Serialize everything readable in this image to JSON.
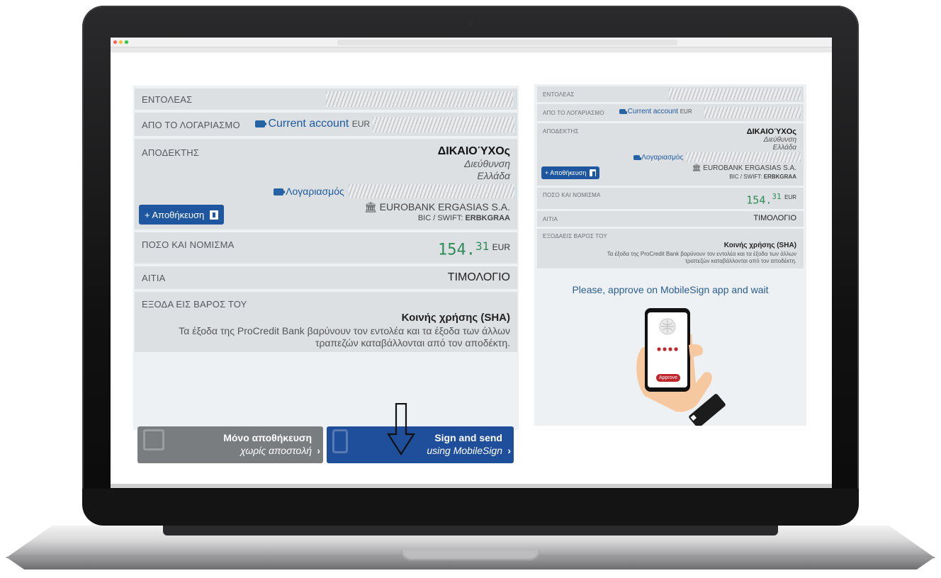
{
  "left": {
    "principal_label": "ΕΝΤΟΛΕΑΣ",
    "from_account_label": "ΑΠΟ ΤΟ ΛΟΓΑΡΙΑΣΜΟ",
    "from_account_name": "Current account",
    "from_account_currency": "EUR",
    "beneficiary_label": "ΑΠΟΔΕΚΤΗΣ",
    "beneficiary_name": "ΔΙΚΑΙΟΎΧΟς",
    "beneficiary_address": "Διεύθυνση",
    "beneficiary_country": "Ελλάδα",
    "account_link": "Λογαριασμός",
    "bank_name": "EUROBANK ERGASIAS S.A.",
    "bic_label": "BIC / SWIFT:",
    "bic_value": "ERBKGRAA",
    "save_button": "+ Αποθήκευση",
    "amount_label": "ΠΟΣΟ ΚΑΙ ΝΟΜΙΣΜΑ",
    "amount_int": "154.",
    "amount_dec": "31",
    "amount_currency": "EUR",
    "reason_label": "ΑΙΤΙΑ",
    "reason_value": "ΤΙΜΟΛΟΓΙΟ",
    "charges_label": "ΕΞΟΔΑ ΕΙΣ ΒΑΡΟΣ ΤΟΥ",
    "charges_value": "Κοινής χρήσης (SHA)",
    "charges_desc_1": "Τα έξοδα της ProCredit Bank βαρύνουν τον εντολέα και τα έξοδα των άλλων",
    "charges_desc_2": "τραπεζών καταβάλλονται από τον αποδέκτη.",
    "save_only_main": "Μόνο αποθήκευση",
    "save_only_sub": "χωρίς αποστολή",
    "sign_send_main": "Sign and send",
    "sign_send_sub": "using MobileSign",
    "chevron": "›"
  },
  "right": {
    "principal_label": "ΕΝΤΟΛΕΑΣ",
    "from_account_label": "ΑΠΟ ΤΟ ΛΟΓΑΡΙΑΣΜΟ",
    "from_account_name": "Current account",
    "from_account_currency": "EUR",
    "beneficiary_label": "ΑΠΟΔΕΚΤΗΣ",
    "beneficiary_name": "ΔΙΚΑΙΟΎΧΟς",
    "beneficiary_address": "Διεύθυνση",
    "beneficiary_country": "Ελλάδα",
    "account_link": "Λογαριασμός",
    "bank_name": "EUROBANK ERGASIAS S.A.",
    "bic_label": "BIC / SWIFT:",
    "bic_value": "ERBKGRAA",
    "save_button": "+ Αποθήκευση",
    "amount_label": "ΠΟΣΟ ΚΑΙ ΝΟΜΙΣΜΑ",
    "amount_int": "154.",
    "amount_dec": "31",
    "amount_currency": "EUR",
    "reason_label": "ΑΙΤΙΑ",
    "reason_value": "ΤΙΜΟΛΟΓΙΟ",
    "charges_label": "ΕΞΟΔΑΕΙΣ ΒΑΡΟΣ ΤΟΥ",
    "charges_value": "Κοινής χρήσης (SHA)",
    "charges_desc_1": "Τα έξοδα της ProCredit Bank βαρύνουν τον εντολέα και τα έξοδα των άλλων",
    "charges_desc_2": "τραπεζών καταβάλλονται από τον αποδέκτη.",
    "approve_prompt": "Please, approve on MobileSign app and wait",
    "phone_dots": "••••",
    "approve_button": "Approve"
  },
  "colors": {
    "accent": "#1f56a0",
    "amount": "#2e8b57",
    "grey_button": "#7a7d80"
  }
}
